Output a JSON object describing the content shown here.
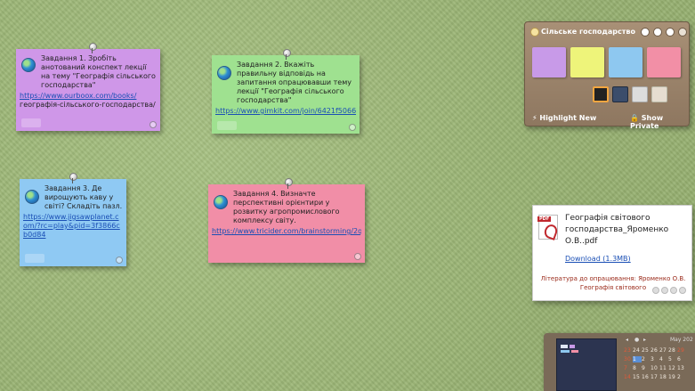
{
  "notes": [
    {
      "text": "Завдання 1. Зробіть анотований конспект лекції на тему \"Географія сільського господарства\"",
      "link": "https://www.ourboox.com/books/",
      "link2": "географія-сільського-господарства/"
    },
    {
      "text": "Завдання 2. Вкажіть правильну відповідь на запитання опрацювавши тему лекції \"Географія сільського господарства\"",
      "link": "https://www.gimkit.com/join/6421f5066"
    },
    {
      "text": "Завдання 3. Де вирощують каву у світі? Складіть пазл.",
      "link": "https://www.jigsawplanet.com/?rc=play&pid=3f3866cb0d84"
    },
    {
      "text": "Завдання 4. Визначте перспективні орієнтири у розвитку агропромислового комплексу світу.",
      "link": "https://www.tricider.com/brainstorming/2qT"
    }
  ],
  "panel": {
    "title": "Сільське господарство",
    "highlight_label": "Highlight New",
    "show_private_label": "Show Private",
    "swatches": [
      "#c89ae8",
      "#eef47a",
      "#8ec8f0",
      "#f28fa6"
    ]
  },
  "file_card": {
    "file_name": "Географія світового господарства_Яроменко О.В..pdf",
    "download_label": "Download (1.3MB)",
    "literature": "Література до опрацювання: Яроменко О.В. Географія світового"
  },
  "calendar": {
    "month_label": "May 202",
    "weeks": [
      [
        "23",
        "24",
        "25",
        "26",
        "27",
        "28",
        "29"
      ],
      [
        "30",
        "1",
        "2",
        "3",
        "4",
        "5",
        "6"
      ],
      [
        "7",
        "8",
        "9",
        "10",
        "11",
        "12",
        "13"
      ],
      [
        "14",
        "15",
        "16",
        "17",
        "18",
        "19",
        "2"
      ]
    ]
  }
}
